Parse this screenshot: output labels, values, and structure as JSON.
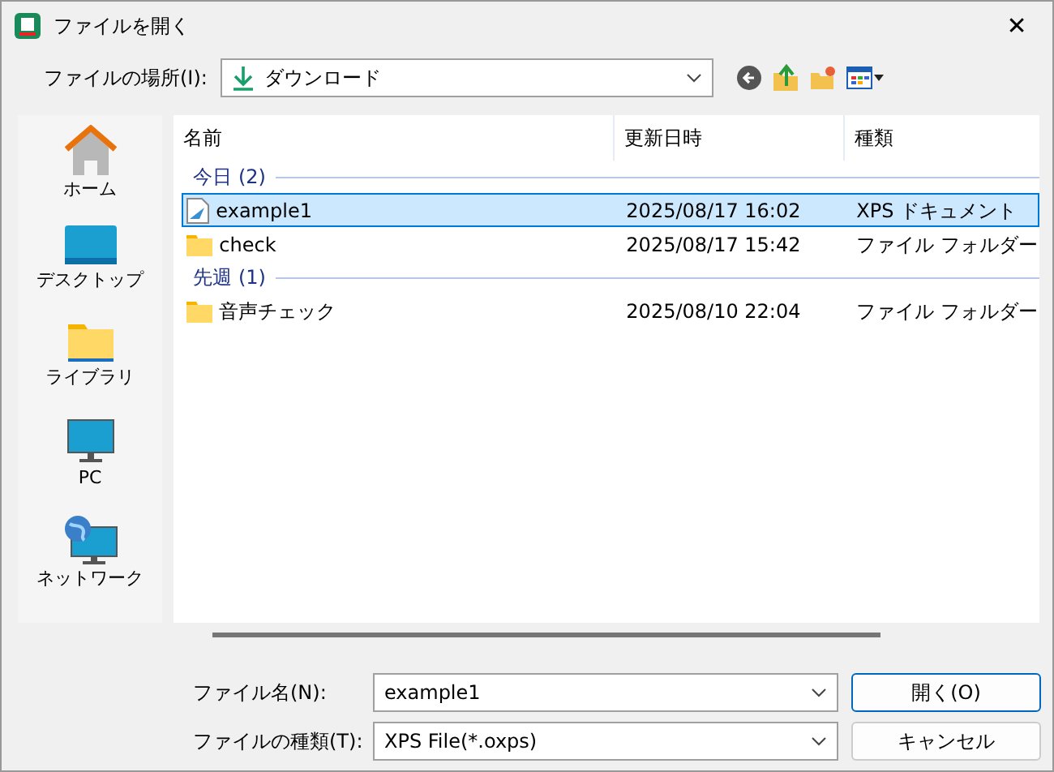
{
  "window": {
    "title": "ファイルを開く",
    "close": "✕"
  },
  "location": {
    "label": "ファイルの場所(I):",
    "value": "ダウンロード"
  },
  "sidebar": {
    "items": [
      {
        "label": "ホーム",
        "kind": "home"
      },
      {
        "label": "デスクトップ",
        "kind": "desktop"
      },
      {
        "label": "ライブラリ",
        "kind": "library"
      },
      {
        "label": "PC",
        "kind": "pc"
      },
      {
        "label": "ネットワーク",
        "kind": "network"
      }
    ]
  },
  "file_list": {
    "columns": [
      "名前",
      "更新日時",
      "種類"
    ],
    "groups": [
      {
        "label": "今日 (2)",
        "rows": [
          {
            "name": "example1",
            "modified": "2025/08/17 16:02",
            "type": "XPS ドキュメント",
            "kind": "document",
            "selected": true
          },
          {
            "name": "check",
            "modified": "2025/08/17 15:42",
            "type": "ファイル フォルダー",
            "kind": "folder",
            "selected": false
          }
        ]
      },
      {
        "label": "先週 (1)",
        "rows": [
          {
            "name": "音声チェック",
            "modified": "2025/08/10 22:04",
            "type": "ファイル フォルダー",
            "kind": "folder",
            "selected": false
          }
        ]
      }
    ]
  },
  "file_name": {
    "label": "ファイル名(N):",
    "value": "example1"
  },
  "file_type": {
    "label": "ファイルの種類(T):",
    "value": "XPS File(*.oxps)"
  },
  "buttons": [
    {
      "label": "開く(O)",
      "kind": "primary"
    },
    {
      "label": "キャンセル",
      "kind": "secondary"
    }
  ]
}
